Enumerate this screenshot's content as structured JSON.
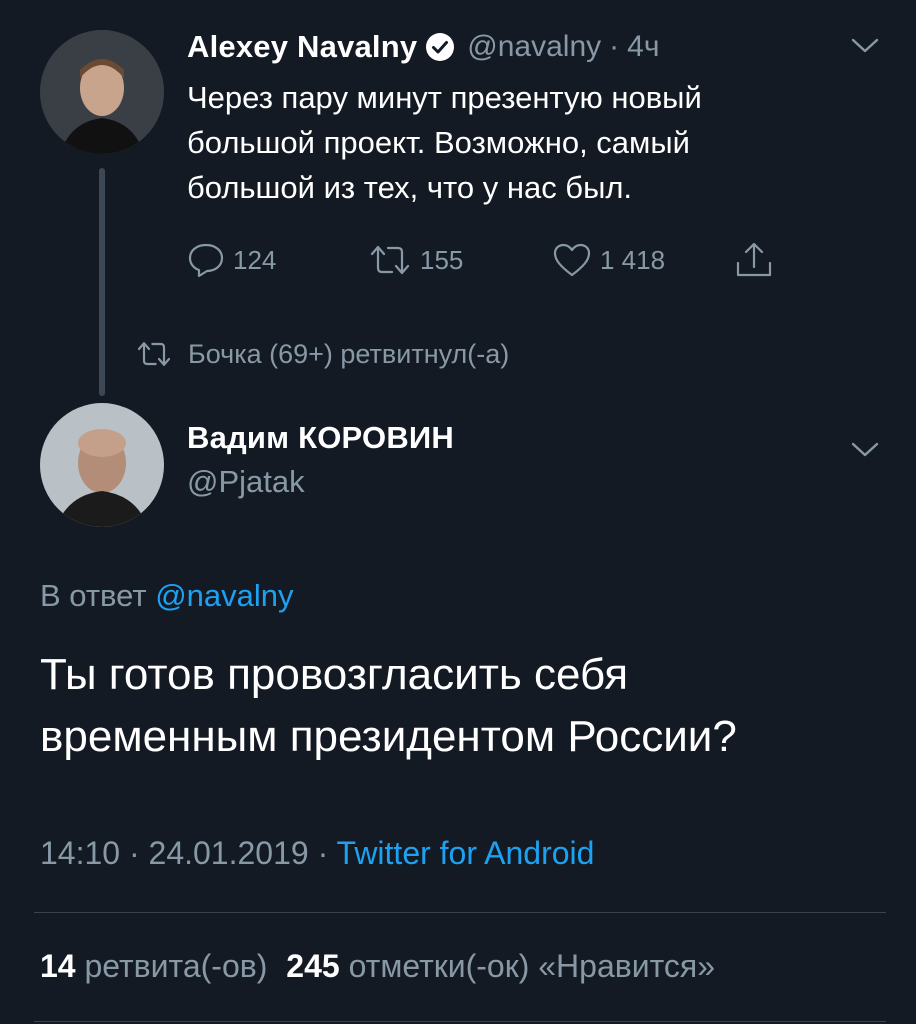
{
  "tweet1": {
    "name": "Alexey Navalny",
    "handle": "@navalny",
    "time_sep": "·",
    "time": "4ч",
    "text_lines": [
      "Через пару минут презентую новый",
      "большой проект. Возможно, самый",
      "большой из тех, что у нас был."
    ],
    "replies": "124",
    "retweets": "155",
    "likes": "1 418",
    "avatar_icon": "person-photo"
  },
  "retweet_note": "Бочка (69+) ретвитнул(-а)",
  "tweet2": {
    "name": "Вадим КОРОВИН",
    "handle": "@Pjatak",
    "reply_prefix": "В ответ",
    "reply_to": "@navalny",
    "text_lines": [
      "Ты готов провозгласить себя",
      "временным президентом России?"
    ],
    "time": "14:10",
    "sep1": "·",
    "date": "24.01.2019",
    "sep2": "·",
    "source": "Twitter for Android",
    "retweet_count": "14",
    "retweet_label": "ретвита(-ов)",
    "like_count": "245",
    "like_label": "отметки(-ок) «Нравится»"
  },
  "colors": {
    "background": "#141a24",
    "accent": "#1da1f2",
    "muted": "#8899a6"
  }
}
